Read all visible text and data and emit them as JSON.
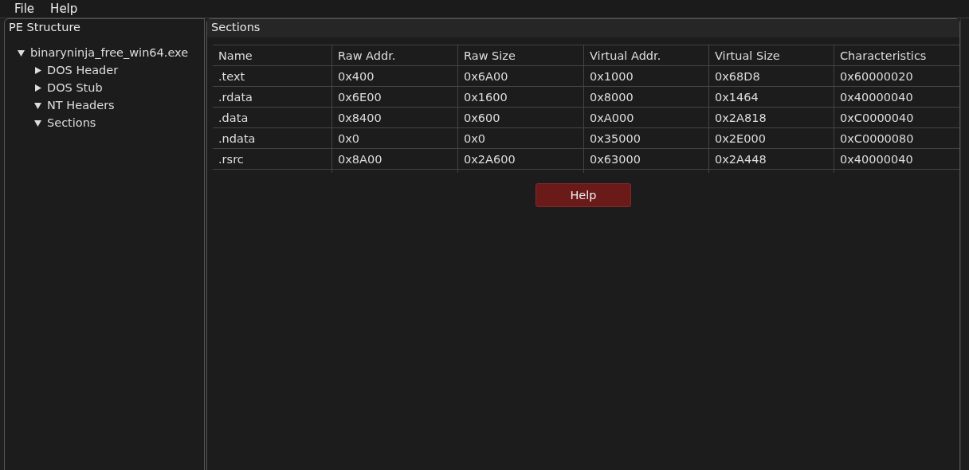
{
  "menu": [
    "File",
    "Help"
  ],
  "structure_panel": {
    "title": "PE Structure",
    "tree": [
      {
        "label": "binaryninja_free_win64.exe",
        "expanded": true,
        "children": [
          {
            "label": "DOS Header",
            "expanded": false
          },
          {
            "label": "DOS Stub",
            "expanded": false
          },
          {
            "label": "NT Headers",
            "expanded": true
          },
          {
            "label": "Sections",
            "expanded": true
          }
        ]
      }
    ]
  },
  "sections_panel": {
    "title": "Sections",
    "table": {
      "columns": [
        "Name",
        "Raw Addr.",
        "Raw Size",
        "Virtual Addr.",
        "Virtual Size",
        "Characteristics"
      ],
      "rows": [
        [
          ".text",
          "0x400",
          "0x6A00",
          "0x1000",
          "0x68D8",
          "0x60000020"
        ],
        [
          ".rdata",
          "0x6E00",
          "0x1600",
          "0x8000",
          "0x1464",
          "0x40000040"
        ],
        [
          ".data",
          "0x8400",
          "0x600",
          "0xA000",
          "0x2A818",
          "0xC0000040"
        ],
        [
          ".ndata",
          "0x0",
          "0x0",
          "0x35000",
          "0x2E000",
          "0xC0000080"
        ],
        [
          ".rsrc",
          "0x8A00",
          "0x2A600",
          "0x63000",
          "0x2A448",
          "0x40000040"
        ]
      ]
    },
    "button": "Help"
  }
}
